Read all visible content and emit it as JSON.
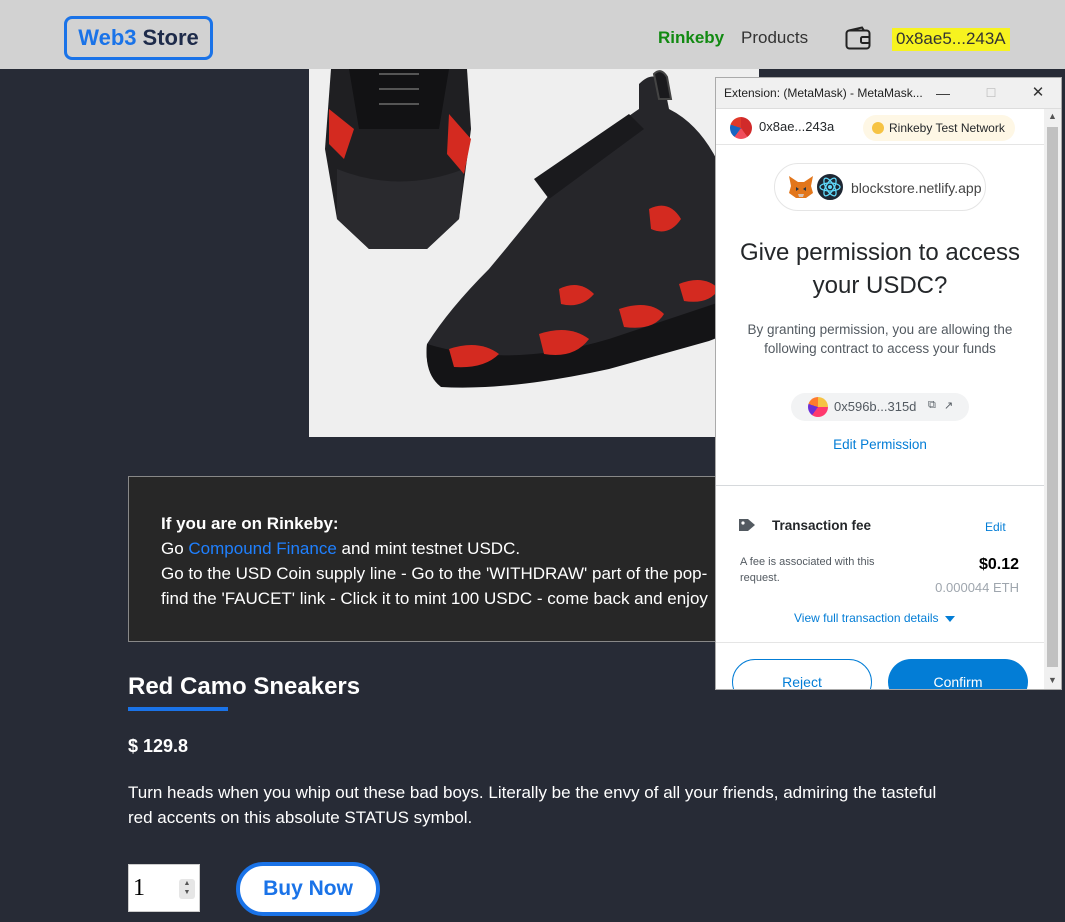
{
  "header": {
    "logo_primary": "Web3",
    "logo_secondary": "Store",
    "network": "Rinkeby",
    "products_link": "Products",
    "account": "0x8ae5...243A"
  },
  "info_box": {
    "heading": "If you are on Rinkeby:",
    "line1_prefix": "Go ",
    "line1_link": "Compound Finance",
    "line1_suffix": " and mint testnet USDC.",
    "line2": "Go to the USD Coin supply line - Go to the 'WITHDRAW' part of the pop-",
    "line3": "find the 'FAUCET' link - Click it to mint 100 USDC - come back and enjoy"
  },
  "product": {
    "title": "Red Camo Sneakers",
    "price": "$ 129.8",
    "description": "Turn heads when you whip out these bad boys. Literally be the envy of all your friends, admiring the tasteful red accents on this absolute STATUS symbol.",
    "quantity": "1",
    "buy_label": "Buy Now"
  },
  "metamask": {
    "window_title": "Extension: (MetaMask) - MetaMask...",
    "account": "0x8ae...243a",
    "network": "Rinkeby Test Network",
    "site": "blockstore.netlify.app",
    "heading": "Give permission to access your USDC?",
    "description": "By granting permission, you are allowing the following contract to access your funds",
    "contract": "0x596b...315d",
    "edit_permission": "Edit Permission",
    "fee_label": "Transaction fee",
    "fee_edit": "Edit",
    "fee_desc": "A fee is associated with this request.",
    "fee_usd": "$0.12",
    "fee_eth": "0.000044 ETH",
    "view_details": "View full transaction details",
    "reject": "Reject",
    "confirm": "Confirm"
  },
  "colors": {
    "accent": "#1a73e8",
    "metamask_blue": "#037dd6",
    "network_green": "#128a12",
    "account_highlight": "#f7f31f",
    "background": "#272b36"
  }
}
